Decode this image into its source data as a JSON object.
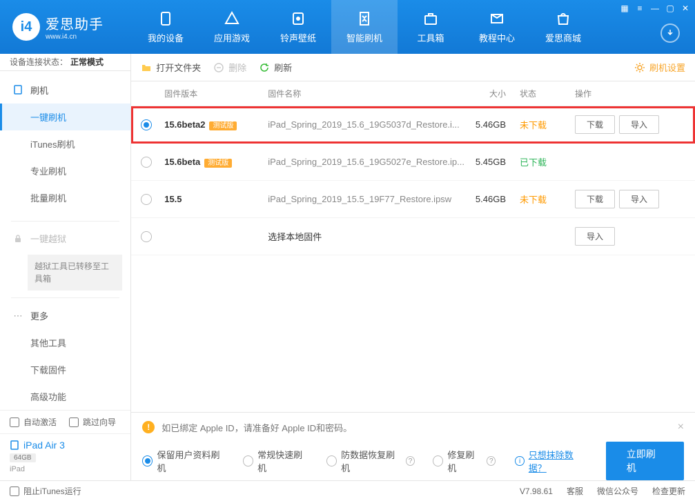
{
  "app": {
    "name": "爱思助手",
    "url": "www.i4.cn"
  },
  "nav": [
    {
      "id": "device",
      "label": "我的设备"
    },
    {
      "id": "apps",
      "label": "应用游戏"
    },
    {
      "id": "ring",
      "label": "铃声壁纸"
    },
    {
      "id": "flash",
      "label": "智能刷机"
    },
    {
      "id": "tools",
      "label": "工具箱"
    },
    {
      "id": "tutorial",
      "label": "教程中心"
    },
    {
      "id": "store",
      "label": "爱思商城"
    }
  ],
  "status": {
    "label": "设备连接状态：",
    "value": "正常模式"
  },
  "sidebar": {
    "group1": {
      "title": "刷机",
      "items": [
        "一键刷机",
        "iTunes刷机",
        "专业刷机",
        "批量刷机"
      ]
    },
    "group2": {
      "title": "一键越狱",
      "note": "越狱工具已转移至工具箱"
    },
    "group3": {
      "title": "更多",
      "items": [
        "其他工具",
        "下载固件",
        "高级功能"
      ]
    },
    "auto": {
      "activate": "自动激活",
      "skip": "跳过向导"
    },
    "device": {
      "name": "iPad Air 3",
      "storage": "64GB",
      "type": "iPad"
    }
  },
  "toolbar": {
    "open": "打开文件夹",
    "delete": "删除",
    "refresh": "刷新",
    "settings": "刷机设置"
  },
  "table": {
    "headers": {
      "ver": "固件版本",
      "name": "固件名称",
      "size": "大小",
      "status": "状态",
      "ops": "操作"
    },
    "rows": [
      {
        "selected": true,
        "ver": "15.6beta2",
        "beta": "测试版",
        "name": "iPad_Spring_2019_15.6_19G5037d_Restore.i...",
        "size": "5.46GB",
        "status": "未下载",
        "statusCls": "st-orange",
        "ops": [
          "下载",
          "导入"
        ],
        "highlight": true
      },
      {
        "selected": false,
        "ver": "15.6beta",
        "beta": "测试版",
        "name": "iPad_Spring_2019_15.6_19G5027e_Restore.ip...",
        "size": "5.45GB",
        "status": "已下载",
        "statusCls": "st-green",
        "ops": []
      },
      {
        "selected": false,
        "ver": "15.5",
        "beta": "",
        "name": "iPad_Spring_2019_15.5_19F77_Restore.ipsw",
        "size": "5.46GB",
        "status": "未下载",
        "statusCls": "st-orange",
        "ops": [
          "下载",
          "导入"
        ]
      },
      {
        "selected": false,
        "ver": "",
        "beta": "",
        "name": "选择本地固件",
        "nameDark": true,
        "size": "",
        "status": "",
        "statusCls": "",
        "ops": [
          "导入"
        ]
      }
    ]
  },
  "alert": "如已绑定 Apple ID，请准备好 Apple ID和密码。",
  "flashOptions": [
    "保留用户资料刷机",
    "常规快速刷机",
    "防数据恢复刷机",
    "修复刷机"
  ],
  "eraseLink": "只想抹除数据？",
  "flashBtn": "立即刷机",
  "footer": {
    "block": "阻止iTunes运行",
    "version": "V7.98.61",
    "links": [
      "客服",
      "微信公众号",
      "检查更新"
    ]
  }
}
